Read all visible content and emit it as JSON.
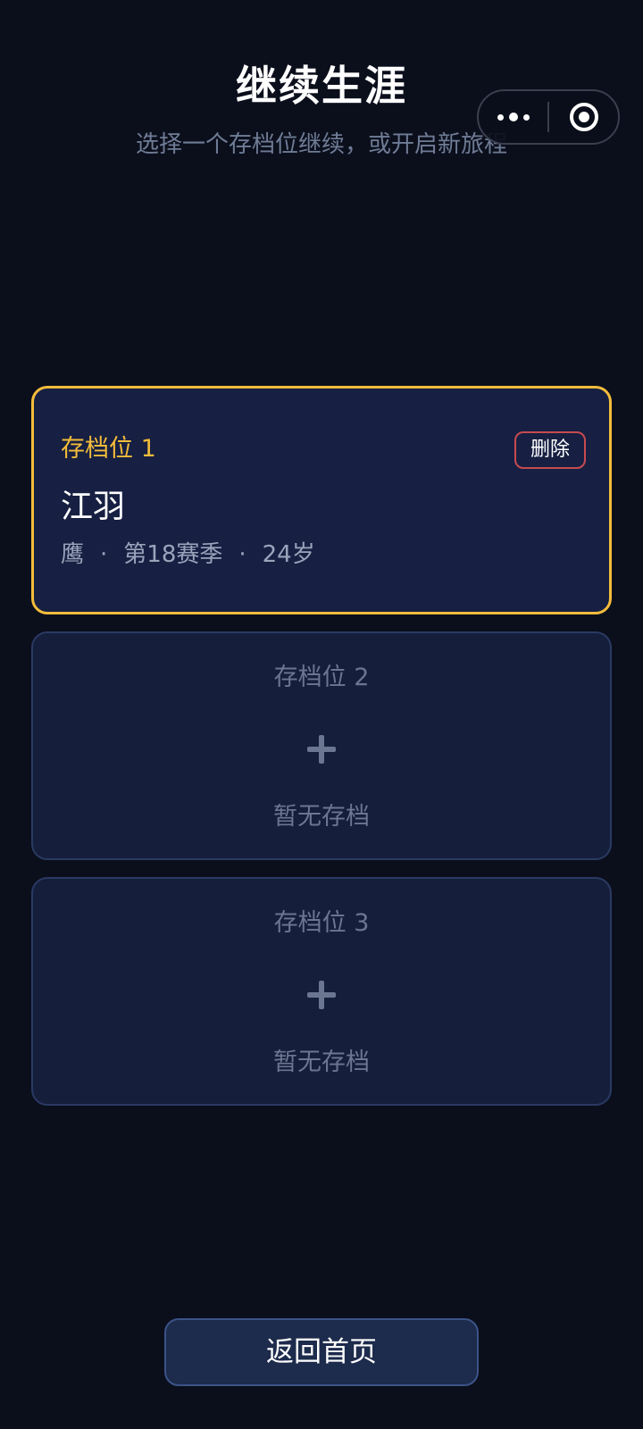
{
  "header": {
    "title": "继续生涯",
    "subtitle": "选择一个存档位继续，或开启新旅程"
  },
  "capsule": {
    "more_icon": "more-dots-icon",
    "close_icon": "target-close-icon"
  },
  "slots": [
    {
      "label": "存档位 1",
      "delete_label": "删除",
      "name": "江羽",
      "meta": [
        "鹰",
        "第18赛季",
        "24岁"
      ],
      "meta_separator": "·"
    },
    {
      "label": "存档位 2",
      "empty_text": "暂无存档",
      "icon": "plus-icon"
    },
    {
      "label": "存档位 3",
      "empty_text": "暂无存档",
      "icon": "plus-icon"
    }
  ],
  "footer": {
    "home_label": "返回首页"
  },
  "colors": {
    "background": "#0b0f1c",
    "card": "#151e3a",
    "accent": "#f4bc3b",
    "danger": "#c74a4f",
    "muted": "#6b7691"
  }
}
